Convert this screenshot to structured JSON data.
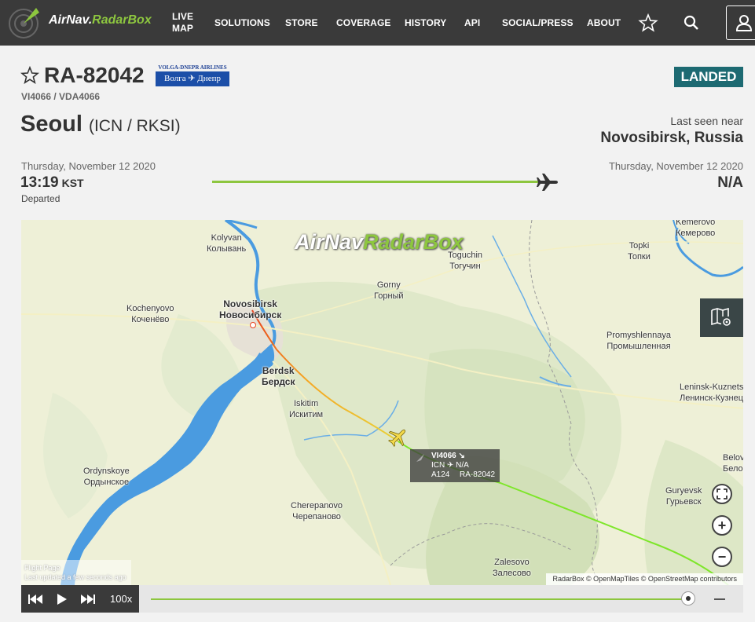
{
  "nav": {
    "logo_part1": "AirNav.",
    "logo_part2": "RadarBox",
    "items": [
      "LIVE\nMAP",
      "SOLUTIONS",
      "STORE",
      "COVERAGE",
      "HISTORY",
      "API",
      "SOCIAL/PRESS",
      "ABOUT"
    ],
    "icons": [
      "star-icon",
      "search-icon",
      "user-icon"
    ]
  },
  "flight": {
    "registration": "RA-82042",
    "airline_logo_top": "VOLGA-DNEPR AIRLINES",
    "airline_logo_main": "Волга ✈ Днепр",
    "flight_ids": "VI4066 / VDA4066",
    "status": "LANDED",
    "origin_city": "Seoul",
    "origin_codes": "(ICN / RKSI)",
    "last_seen_label": "Last seen near",
    "last_seen_location": "Novosibirsk, Russia",
    "departure_date": "Thursday, November 12 2020",
    "departure_time": "13:19",
    "departure_tz": "KST",
    "departure_label": "Departed",
    "arrival_date": "Thursday, November 12 2020",
    "arrival_time": "N/A",
    "progress": 1.0
  },
  "map": {
    "watermark_a": "AirNav",
    "watermark_b": "RadarBox",
    "cities": [
      {
        "en": "Kemerovo",
        "ru": "Кемерово"
      },
      {
        "en": "Kolyvan",
        "ru": "Колывань"
      },
      {
        "en": "Toguchin",
        "ru": "Тогучин"
      },
      {
        "en": "Topki",
        "ru": "Топки"
      },
      {
        "en": "Gorny",
        "ru": "Горный"
      },
      {
        "en": "Kochenyovo",
        "ru": "Коченёво"
      },
      {
        "en": "Novosibirsk",
        "ru": "Новосибирск"
      },
      {
        "en": "Promyshlennaya",
        "ru": "Промышленная"
      },
      {
        "en": "Berdsk",
        "ru": "Бердск"
      },
      {
        "en": "Iskitim",
        "ru": "Искитим"
      },
      {
        "en": "Leninsk-Kuznetsky",
        "ru": "Ленинск-Кузнецкий"
      },
      {
        "en": "Belovo",
        "ru": "Белово"
      },
      {
        "en": "Ordynskoye",
        "ru": "Ордынское"
      },
      {
        "en": "Guryevsk",
        "ru": "Гурьевск"
      },
      {
        "en": "Cherepanovo",
        "ru": "Черепаново"
      },
      {
        "en": "Zalesovo",
        "ru": "Залесово"
      }
    ],
    "aircraft_label": {
      "flight": "VI4066 ↘",
      "route": "ICN ✈ N/A",
      "type": "A124",
      "reg": "RA-82042"
    },
    "attribution": "RadarBox © OpenMapTiles © OpenStreetMap contributors",
    "flight_page_line1": "Flight Page",
    "flight_page_line2": "Last updated a few seconds ago",
    "controls": [
      "fullscreen-icon",
      "zoom-in-icon",
      "zoom-out-icon",
      "map-layers-icon"
    ],
    "zoom_in_symbol": "+",
    "zoom_out_symbol": "−"
  },
  "playback": {
    "speed": "100x",
    "progress": 0.96
  },
  "colors": {
    "nav_bg": "#3a3a3a",
    "accent_green": "#8dc63f",
    "status_teal": "#1d6a72",
    "water": "#4a9be0",
    "track_green": "#7ee62a",
    "track_orange": "#f5a623",
    "track_red": "#e8401c"
  }
}
